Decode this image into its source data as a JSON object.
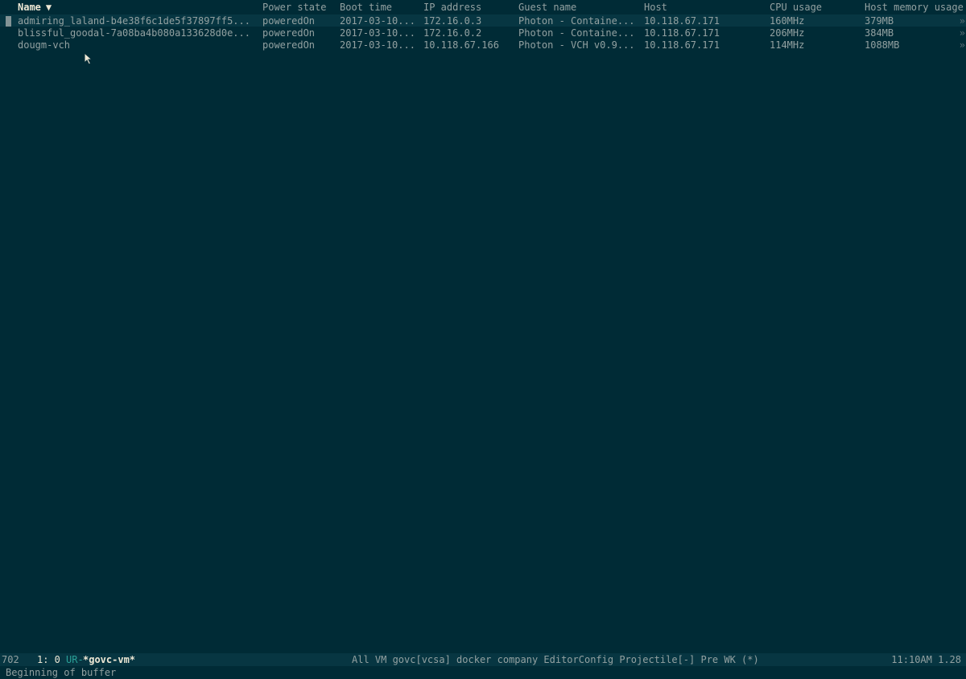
{
  "table": {
    "columns": [
      {
        "label": "Name",
        "sorted": true
      },
      {
        "label": "Power state"
      },
      {
        "label": "Boot time"
      },
      {
        "label": "IP address"
      },
      {
        "label": "Guest name"
      },
      {
        "label": "Host"
      },
      {
        "label": "CPU usage"
      },
      {
        "label": "Host memory usage"
      }
    ],
    "sort_icon": "sort-descending-triangle",
    "rows": [
      {
        "name": "admiring_laland-b4e38f6c1de5f37897ff5...",
        "power": "poweredOn",
        "boot": "2017-03-10...",
        "ip": "172.16.0.3",
        "guest": "Photon - Containe...",
        "host": "10.118.67.171",
        "cpu": "160MHz",
        "mem": "379MB"
      },
      {
        "name": "blissful_goodal-7a08ba4b080a133628d0e...",
        "power": "poweredOn",
        "boot": "2017-03-10...",
        "ip": "172.16.0.2",
        "guest": "Photon - Containe...",
        "host": "10.118.67.171",
        "cpu": "206MHz",
        "mem": "384MB"
      },
      {
        "name": "dougm-vch",
        "power": "poweredOn",
        "boot": "2017-03-10...",
        "ip": "10.118.67.166",
        "guest": "Photon - VCH v0.9...",
        "host": "10.118.67.171",
        "cpu": "114MHz",
        "mem": "1088MB"
      }
    ]
  },
  "modeline": {
    "line_no": "702",
    "position": "1: 0",
    "flags": "UR-",
    "buffer": "*govc-vm*",
    "modes": "All VM govc[vcsa] docker company EditorConfig Projectile[-] Pre WK (*)",
    "time_load": "11:10AM 1.28"
  },
  "echo_area": {
    "message": "Beginning of buffer"
  },
  "colors": {
    "background": "#002b36",
    "modeline_bg": "#073642",
    "text": "#93a1a1"
  }
}
